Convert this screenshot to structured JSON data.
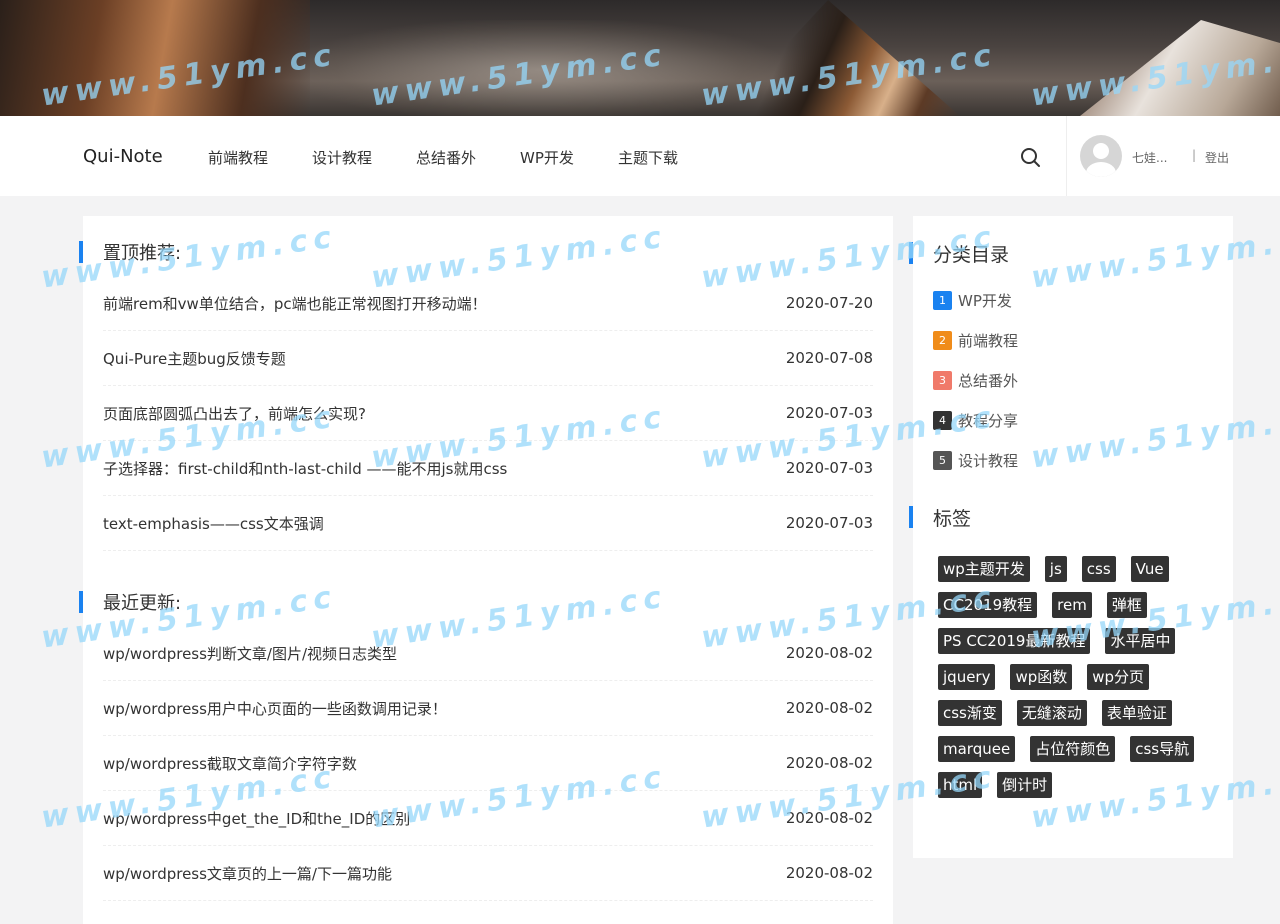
{
  "header": {
    "brand": "Qui-Note",
    "nav": [
      "前端教程",
      "设计教程",
      "总结番外",
      "WP开发",
      "主题下载"
    ],
    "user_name": "七娃...",
    "separator": "|",
    "login_label": "登出"
  },
  "watermark": "www.51ym.cc",
  "main": {
    "pinned_title": "置顶推荐:",
    "pinned_posts": [
      {
        "title": "前端rem和vw单位结合，pc端也能正常视图打开移动端！",
        "date": "2020-07-20"
      },
      {
        "title": "Qui-Pure主题bug反馈专题",
        "date": "2020-07-08"
      },
      {
        "title": "页面底部圆弧凸出去了，前端怎么实现?",
        "date": "2020-07-03"
      },
      {
        "title": "子选择器：first-child和nth-last-child ——能不用js就用css",
        "date": "2020-07-03"
      },
      {
        "title": "text-emphasis——css文本强调",
        "date": "2020-07-03"
      }
    ],
    "recent_title": "最近更新:",
    "recent_posts": [
      {
        "title": "wp/wordpress判断文章/图片/视频日志类型",
        "date": "2020-08-02"
      },
      {
        "title": "wp/wordpress用户中心页面的一些函数调用记录！",
        "date": "2020-08-02"
      },
      {
        "title": "wp/wordpress截取文章简介字符字数",
        "date": "2020-08-02"
      },
      {
        "title": "wp/wordpress中get_the_ID和the_ID的区别",
        "date": "2020-08-02"
      },
      {
        "title": "wp/wordpress文章页的上一篇/下一篇功能",
        "date": "2020-08-02"
      }
    ]
  },
  "sidebar": {
    "category_title": "分类目录",
    "categories": [
      {
        "num": "1",
        "label": "WP开发",
        "color": "#1a82f0"
      },
      {
        "num": "2",
        "label": "前端教程",
        "color": "#f08c1a"
      },
      {
        "num": "3",
        "label": "总结番外",
        "color": "#f07a6a"
      },
      {
        "num": "4",
        "label": "教程分享",
        "color": "#333333"
      },
      {
        "num": "5",
        "label": "设计教程",
        "color": "#555555"
      }
    ],
    "tag_title": "标签",
    "tags": [
      "wp主题开发",
      "js",
      "css",
      "Vue",
      "CC2019教程",
      "rem",
      "弹框",
      "PS CC2019最新教程",
      "水平居中",
      "jquery",
      "wp函数",
      "wp分页",
      "css渐变",
      "无缝滚动",
      "表单验证",
      "marquee",
      "占位符颜色",
      "css导航",
      "html",
      "倒计时"
    ]
  }
}
